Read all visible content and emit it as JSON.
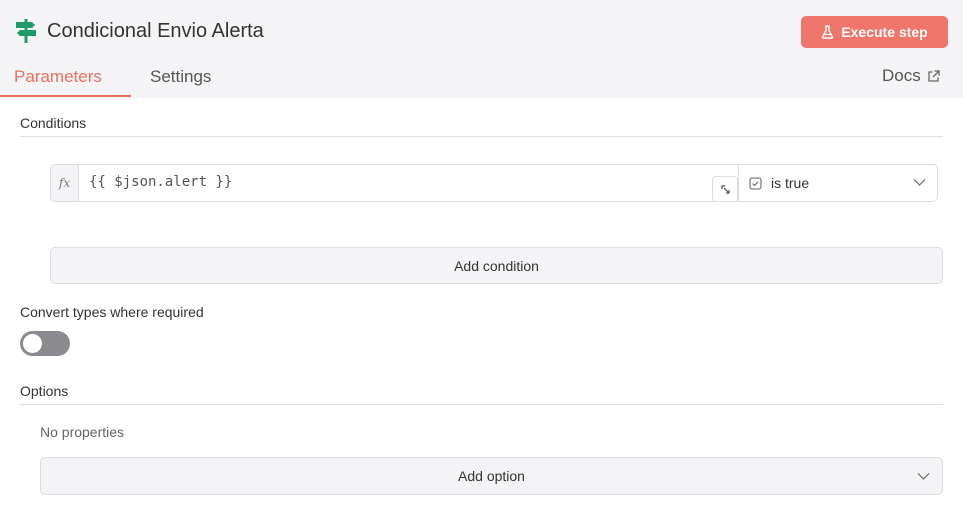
{
  "header": {
    "node_icon": "signpost-icon",
    "title": "Condicional Envio Alerta",
    "execute_label": "Execute step",
    "accent_color": "#f0756b"
  },
  "tabs": [
    {
      "label": "Parameters",
      "active": true
    },
    {
      "label": "Settings",
      "active": false
    }
  ],
  "docs": {
    "label": "Docs",
    "icon": "external-link-icon"
  },
  "conditions": {
    "section_label": "Conditions",
    "rows": [
      {
        "fx_label": "fx",
        "expression": "{{ $json.alert }}",
        "operator": "is true"
      }
    ],
    "add_label": "Add condition"
  },
  "convert_types": {
    "label": "Convert types where required",
    "enabled": false
  },
  "options": {
    "section_label": "Options",
    "empty_text": "No properties",
    "add_label": "Add option"
  }
}
